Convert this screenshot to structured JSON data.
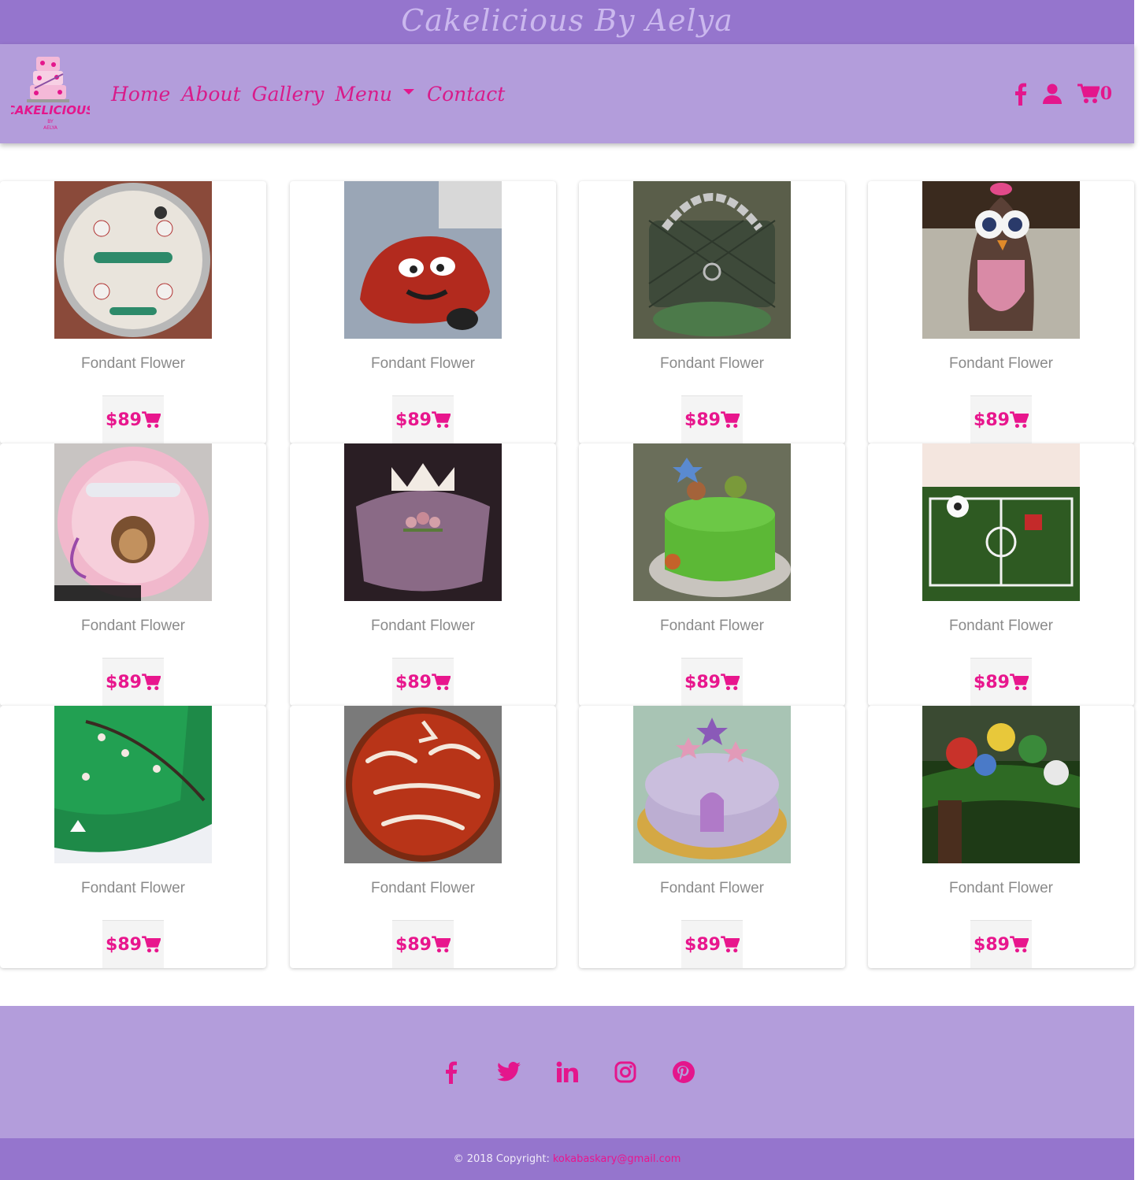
{
  "site": {
    "title": "Cakelicious By Aelya"
  },
  "logo": {
    "text": "CAKELICIOUS",
    "sub": "BY",
    "sub2": "AELYA"
  },
  "nav": {
    "home": "Home",
    "about": "About",
    "gallery": "Gallery",
    "menu": "Menu",
    "contact": "Contact",
    "cart_count": "0"
  },
  "icons": {
    "facebook": "facebook-icon",
    "user": "user-icon",
    "cart": "shopping-cart-icon",
    "twitter": "twitter-icon",
    "linkedin": "linkedin-icon",
    "instagram": "instagram-icon",
    "pinterest": "pinterest-icon"
  },
  "colors": {
    "accent": "#e8168d",
    "header": "#9575cd",
    "nav": "#b39ddb"
  },
  "products": [
    {
      "name": "Fondant Flower",
      "price": "$89"
    },
    {
      "name": "Fondant Flower",
      "price": "$89"
    },
    {
      "name": "Fondant Flower",
      "price": "$89"
    },
    {
      "name": "Fondant Flower",
      "price": "$89"
    },
    {
      "name": "Fondant Flower",
      "price": "$89"
    },
    {
      "name": "Fondant Flower",
      "price": "$89"
    },
    {
      "name": "Fondant Flower",
      "price": "$89"
    },
    {
      "name": "Fondant Flower",
      "price": "$89"
    },
    {
      "name": "Fondant Flower",
      "price": "$89"
    },
    {
      "name": "Fondant Flower",
      "price": "$89"
    },
    {
      "name": "Fondant Flower",
      "price": "$89"
    },
    {
      "name": "Fondant Flower",
      "price": "$89"
    }
  ],
  "footer": {
    "copyright": "© 2018 Copyright:",
    "email": "kokabaskary@gmail.com"
  }
}
